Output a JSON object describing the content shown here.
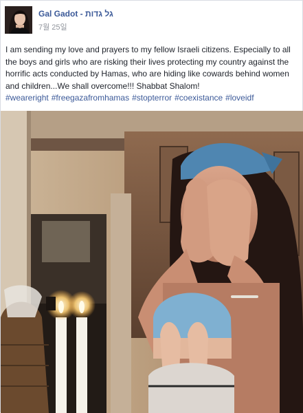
{
  "post": {
    "author": "Gal Gadot - גל גדות",
    "timestamp": "7월 25일",
    "text": "I am sending my love and prayers to my fellow Israeli citizens. Especially to all the boys and girls who are risking their lives protecting my country against the horrific acts conducted by Hamas, who are hiding like cowards behind women and children...We shall overcome!!! Shabbat Shalom!",
    "hashtags": [
      "#weareright",
      "#freegazafromhamas",
      "#stopterror",
      "#coexistance",
      "#loveidf"
    ]
  },
  "photo": {
    "icon": "photo-image"
  },
  "colors": {
    "link": "#3b5998",
    "text": "#1d2129",
    "meta": "#90949c"
  }
}
